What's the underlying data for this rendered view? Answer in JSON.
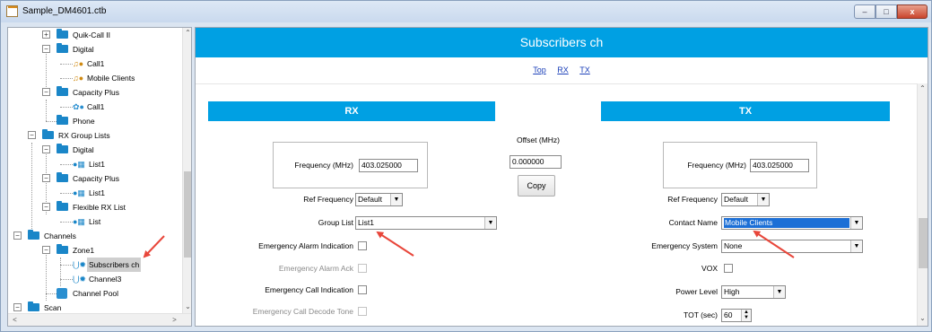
{
  "window": {
    "title": "Sample_DM4601.ctb",
    "buttons": {
      "minimize": "–",
      "maximize": "□",
      "close": "x"
    }
  },
  "tree": {
    "items": [
      {
        "label": "Quik-Call II",
        "icon": "folder-icon",
        "expander": "+"
      },
      {
        "label": "Digital",
        "icon": "folder-icon",
        "expander": "−"
      },
      {
        "label": "Call1",
        "icon": "contact-icon"
      },
      {
        "label": "Mobile Clients",
        "icon": "contact-icon"
      },
      {
        "label": "Capacity Plus",
        "icon": "folder-icon",
        "expander": "−"
      },
      {
        "label": "Call1",
        "icon": "contact-icon"
      },
      {
        "label": "Phone",
        "icon": "folder-icon"
      },
      {
        "label": "RX Group Lists",
        "icon": "folder-icon",
        "expander": "−"
      },
      {
        "label": "Digital",
        "icon": "folder-icon",
        "expander": "−"
      },
      {
        "label": "List1",
        "icon": "list-icon"
      },
      {
        "label": "Capacity Plus",
        "icon": "folder-icon",
        "expander": "−"
      },
      {
        "label": "List1",
        "icon": "list-icon"
      },
      {
        "label": "Flexible RX List",
        "icon": "folder-icon",
        "expander": "−"
      },
      {
        "label": "List",
        "icon": "list-icon"
      },
      {
        "label": "Channels",
        "icon": "folder-icon",
        "expander": "−"
      },
      {
        "label": "Zone1",
        "icon": "folder-icon",
        "expander": "−"
      },
      {
        "label": "Subscribers ch",
        "icon": "channel-icon",
        "selected": true
      },
      {
        "label": "Channel3",
        "icon": "channel-icon"
      },
      {
        "label": "Channel Pool",
        "icon": "channel-pool-icon"
      },
      {
        "label": "Scan",
        "icon": "folder-icon",
        "expander": "−"
      }
    ]
  },
  "content": {
    "banner_title": "Subscribers ch",
    "nav_links": [
      "Top",
      "RX",
      "TX"
    ]
  },
  "rx": {
    "header": "RX",
    "frequency_label": "Frequency (MHz)",
    "frequency_value": "403.025000",
    "ref_frequency_label": "Ref Frequency",
    "ref_frequency_value": "Default",
    "group_list_label": "Group List",
    "group_list_value": "List1",
    "emergency_alarm_indication_label": "Emergency Alarm Indication",
    "emergency_alarm_ack_label": "Emergency Alarm Ack",
    "emergency_call_indication_label": "Emergency Call Indication",
    "emergency_call_decode_tone_label": "Emergency Call Decode Tone"
  },
  "offset": {
    "label": "Offset (MHz)",
    "value": "0.000000",
    "copy_label": "Copy"
  },
  "tx": {
    "header": "TX",
    "frequency_label": "Frequency (MHz)",
    "frequency_value": "403.025000",
    "ref_frequency_label": "Ref Frequency",
    "ref_frequency_value": "Default",
    "contact_name_label": "Contact Name",
    "contact_name_value": "Mobile Clients",
    "emergency_system_label": "Emergency System",
    "emergency_system_value": "None",
    "vox_label": "VOX",
    "power_level_label": "Power Level",
    "power_level_value": "High",
    "tot_label": "TOT (sec)",
    "tot_value": "60"
  },
  "annotation_color": "#e8463a",
  "accent_color": "#00a0e3"
}
